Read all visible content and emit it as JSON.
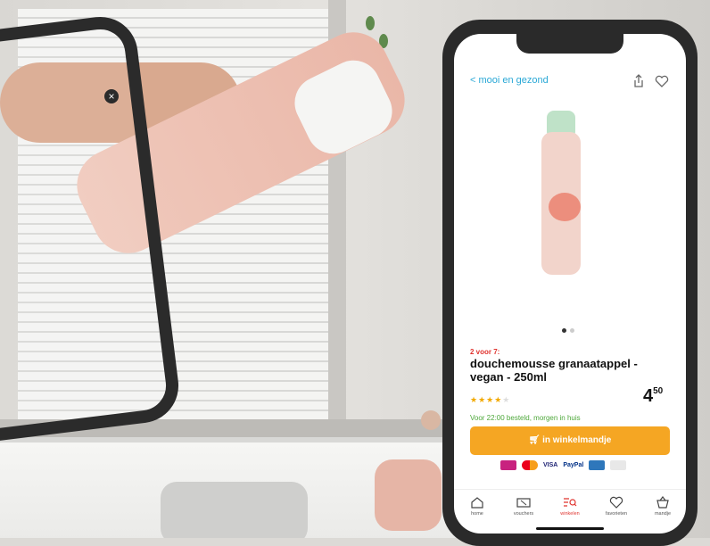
{
  "header": {
    "back_label": "mooi en gezond"
  },
  "product": {
    "promo": "2 voor 7:",
    "title": "douchemousse granaatappel - vegan - 250ml",
    "rating": 3.5,
    "price_main": "4",
    "price_cents": "50",
    "delivery": "Voor 22:00 besteld, morgen in huis"
  },
  "cart_button": {
    "label": "in winkelmandje"
  },
  "payments": [
    "ideal-icon",
    "mastercard-icon",
    "VISA",
    "PayPal",
    "amex-icon",
    "giftcard-icon"
  ],
  "bottom_nav": [
    {
      "label": "home",
      "icon": "home-icon"
    },
    {
      "label": "vouchers",
      "icon": "voucher-icon"
    },
    {
      "label": "winkelen",
      "icon": "search-list-icon"
    },
    {
      "label": "favorieten",
      "icon": "heart-icon"
    },
    {
      "label": "mandje",
      "icon": "basket-icon"
    }
  ],
  "colors": {
    "link": "#2aa8d6",
    "promo": "#e0342f",
    "cta": "#f5a623",
    "delivery": "#4ea83b"
  }
}
